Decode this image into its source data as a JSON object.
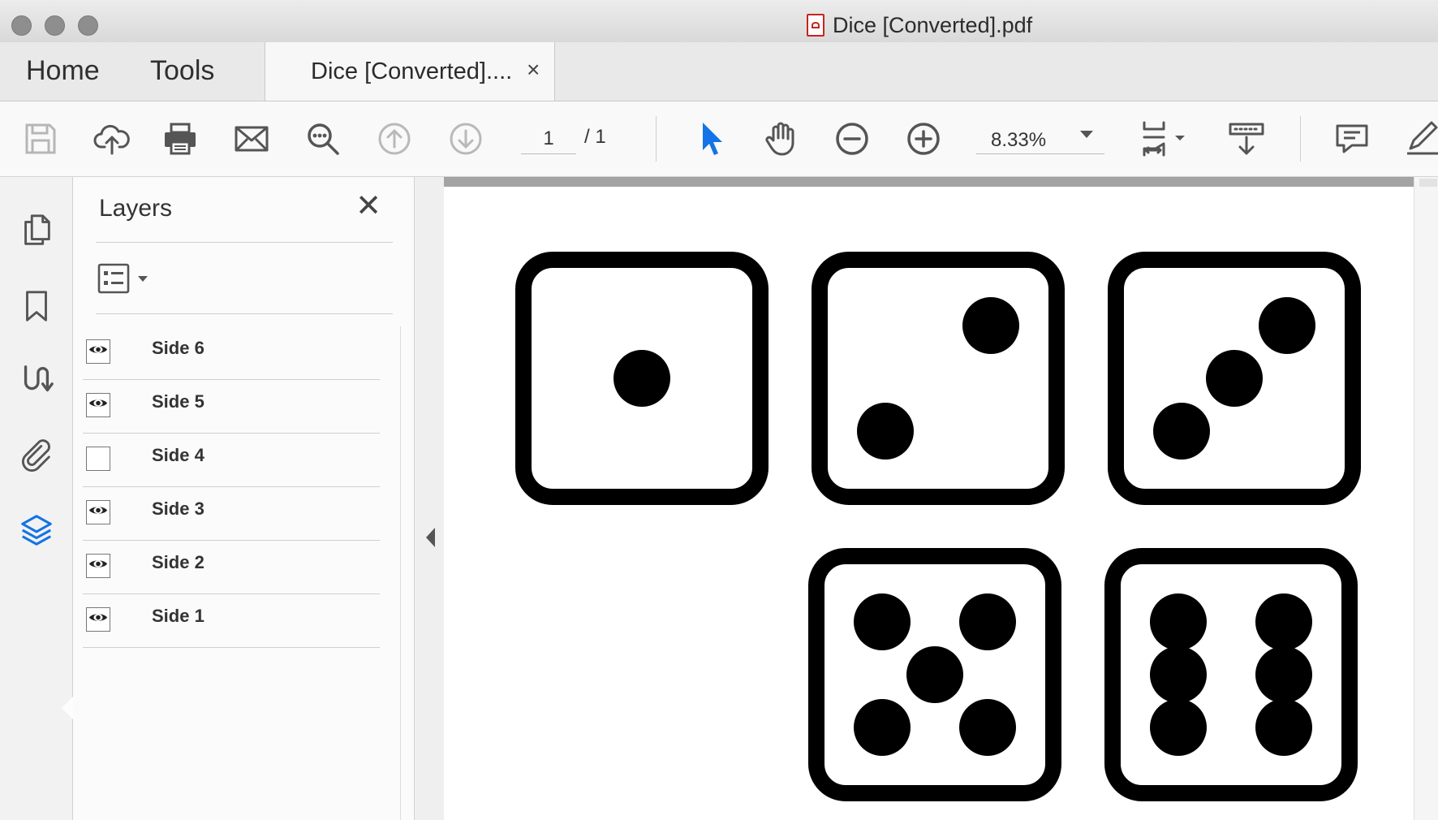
{
  "window": {
    "title": "Dice [Converted].pdf"
  },
  "tabs": {
    "home": "Home",
    "tools": "Tools",
    "document": "Dice [Converted]....",
    "close": "×"
  },
  "toolbar": {
    "icons": [
      "save-icon",
      "upload-cloud-icon",
      "print-icon",
      "email-icon",
      "find-icon",
      "previous-page-icon",
      "next-page-icon",
      "select-arrow-icon",
      "hand-icon",
      "zoom-out-icon",
      "zoom-in-icon",
      "fit-page-icon",
      "read-mode-icon",
      "comment-icon",
      "sign-pen-icon"
    ],
    "page_current": "1",
    "page_total": "/ 1",
    "zoom": "8.33%"
  },
  "rail": {
    "items": [
      "pages-icon",
      "bookmark-icon",
      "signatures-icon",
      "attachments-icon",
      "layers-icon"
    ],
    "active": "layers-icon",
    "accent": "#1473e6"
  },
  "layers_panel": {
    "title": "Layers",
    "close": "✕",
    "layers": [
      {
        "label": "Side 6",
        "visible": true
      },
      {
        "label": "Side 5",
        "visible": true
      },
      {
        "label": "Side 4",
        "visible": false
      },
      {
        "label": "Side 3",
        "visible": true
      },
      {
        "label": "Side 2",
        "visible": true
      },
      {
        "label": "Side 1",
        "visible": true
      }
    ]
  },
  "document": {
    "dice": [
      {
        "value": 1,
        "row": 1,
        "column": 1
      },
      {
        "value": 2,
        "row": 1,
        "column": 2
      },
      {
        "value": 3,
        "row": 1,
        "column": 3
      },
      {
        "value": 5,
        "row": 2,
        "column": 2
      },
      {
        "value": 6,
        "row": 2,
        "column": 3
      }
    ]
  }
}
